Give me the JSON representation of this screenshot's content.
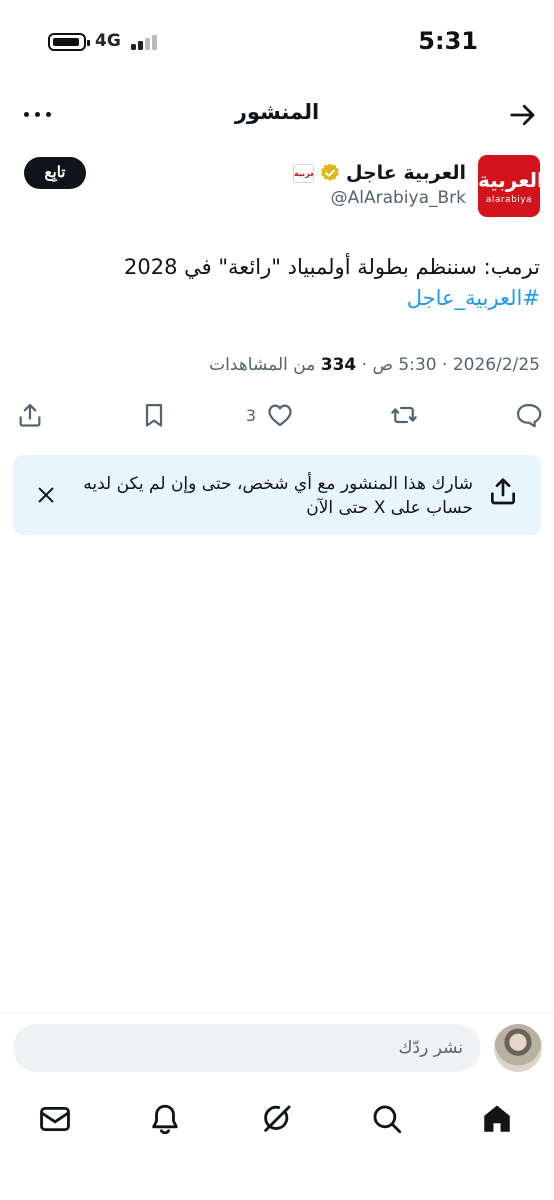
{
  "status_bar": {
    "time": "5:31",
    "network": "4G"
  },
  "header": {
    "title": "المنشور"
  },
  "post": {
    "author": {
      "display_name": "العربية عاجل",
      "handle": "@AlArabiya_Brk",
      "avatar_text_ar": "العربية",
      "avatar_text_en": "alarabiya",
      "affiliate_badge_text": "العربية"
    },
    "follow_label": "تابِع",
    "text": "ترمب: سننظم بطولة أولمبياد \"رائعة\" في 2028",
    "hashtag": "#العربية_عاجل",
    "date": "2026/2/25",
    "time": "5:30 ص",
    "separator": "·",
    "views_count": "334",
    "views_label": "من المشاهدات",
    "like_count": "3"
  },
  "share_banner": {
    "text": "شارك هذا المنشور مع أي شخص، حتى وإن لم يكن لديه حساب على X حتى الآن"
  },
  "reply": {
    "placeholder": "نشر ردّك"
  },
  "tabs": [
    "home",
    "search",
    "grok",
    "notifications",
    "messages"
  ],
  "colors": {
    "brand_red": "#d3121c",
    "link_blue": "#1d9bf0",
    "verified_gold": "#e2b719",
    "banner_bg": "#e8f5fd"
  }
}
